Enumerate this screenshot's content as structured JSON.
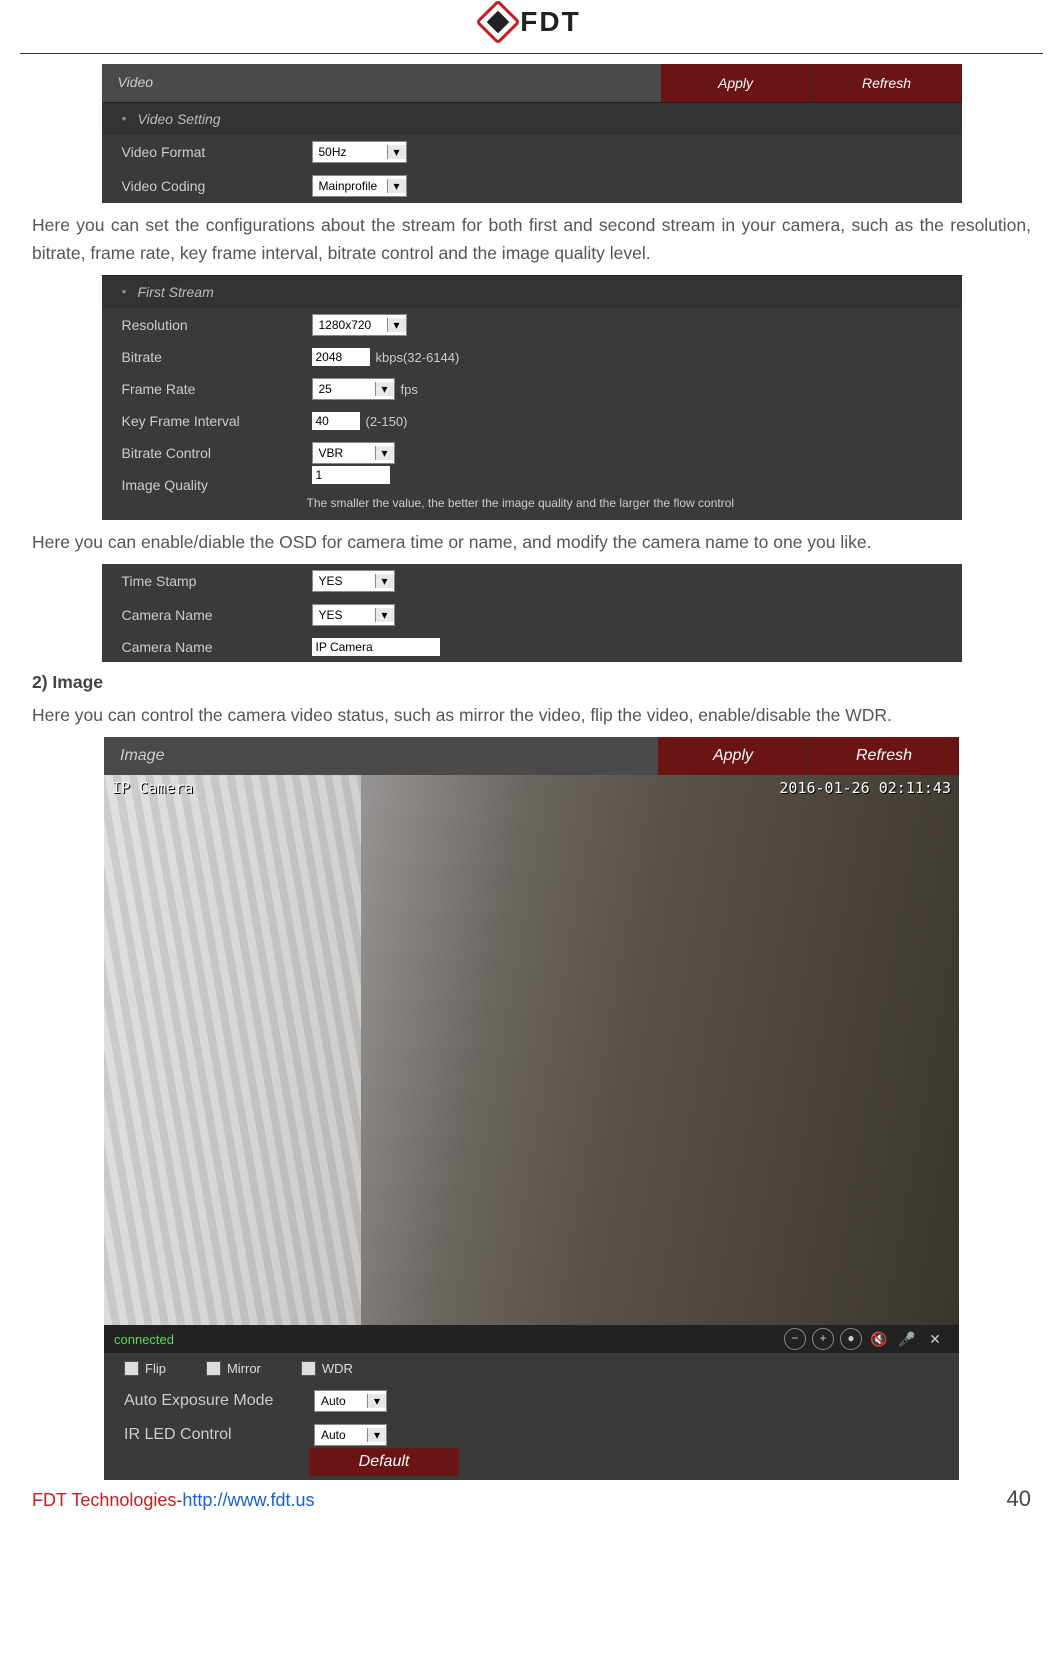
{
  "brand": "FDT",
  "video_panel": {
    "title": "Video",
    "apply": "Apply",
    "refresh": "Refresh",
    "section": "Video Setting",
    "format_label": "Video Format",
    "format_value": "50Hz",
    "coding_label": "Video Coding",
    "coding_value": "Mainprofile"
  },
  "para1": "Here you can set the configurations about the stream for both first and second stream in your camera, such as the resolution, bitrate, frame rate, key frame interval, bitrate control and the image quality level.",
  "stream_panel": {
    "section": "First Stream",
    "resolution_label": "Resolution",
    "resolution_value": "1280x720",
    "bitrate_label": "Bitrate",
    "bitrate_value": "2048",
    "bitrate_suffix": "kbps(32-6144)",
    "framerate_label": "Frame Rate",
    "framerate_value": "25",
    "framerate_suffix": "fps",
    "keyframe_label": "Key Frame Interval",
    "keyframe_value": "40",
    "keyframe_suffix": "(2-150)",
    "bitratectrl_label": "Bitrate Control",
    "bitratectrl_value": "VBR",
    "imgquality_label": "Image Quality",
    "imgquality_value": "1",
    "hint": "The smaller the value, the better the image quality and the larger the flow control"
  },
  "para2": "Here you can enable/diable the OSD for camera time or name, and modify the camera name to one you like.",
  "osd_panel": {
    "timestamp_label": "Time Stamp",
    "timestamp_value": "YES",
    "camname_sel_label": "Camera Name",
    "camname_sel_value": "YES",
    "camname_txt_label": "Camera Name",
    "camname_txt_value": "IP Camera"
  },
  "heading_image": "2) Image",
  "para3": "Here you can control the camera video status, such as mirror the video, flip the video, enable/disable the WDR.",
  "image_panel": {
    "title": "Image",
    "apply": "Apply",
    "refresh": "Refresh",
    "osd_name": "IP Camera",
    "osd_time": "2016-01-26 02:11:43",
    "status": "connected",
    "flip": "Flip",
    "mirror": "Mirror",
    "wdr": "WDR",
    "exposure_label": "Auto Exposure Mode",
    "exposure_value": "Auto",
    "irled_label": "IR LED Control",
    "irled_value": "Auto",
    "default_btn": "Default"
  },
  "footer": {
    "company": "FDT Technologies-",
    "url": "http://www.fdt.us",
    "page": "40"
  }
}
